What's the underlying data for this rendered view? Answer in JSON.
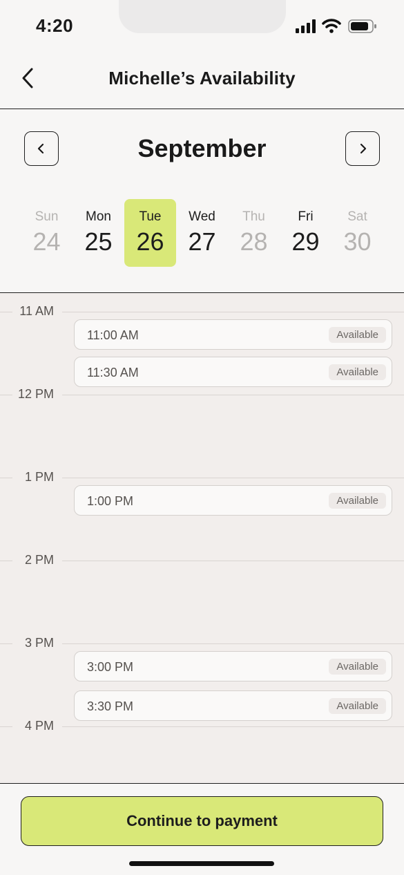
{
  "status_bar": {
    "time": "4:20"
  },
  "header": {
    "title": "Michelle’s Availability"
  },
  "calendar": {
    "month": "September",
    "days": [
      {
        "name": "Sun",
        "number": "24",
        "state": "disabled"
      },
      {
        "name": "Mon",
        "number": "25",
        "state": "enabled"
      },
      {
        "name": "Tue",
        "number": "26",
        "state": "selected"
      },
      {
        "name": "Wed",
        "number": "27",
        "state": "enabled"
      },
      {
        "name": "Thu",
        "number": "28",
        "state": "disabled"
      },
      {
        "name": "Fri",
        "number": "29",
        "state": "enabled"
      },
      {
        "name": "Sat",
        "number": "30",
        "state": "disabled"
      }
    ]
  },
  "schedule": {
    "hours": [
      "11 AM",
      "12 PM",
      "1 PM",
      "2 PM",
      "3 PM",
      "4 PM"
    ],
    "slots": [
      {
        "time": "11:00 AM",
        "status": "Available"
      },
      {
        "time": "11:30 AM",
        "status": "Available"
      },
      {
        "time": "1:00 PM",
        "status": "Available"
      },
      {
        "time": "3:00 PM",
        "status": "Available"
      },
      {
        "time": "3:30 PM",
        "status": "Available"
      }
    ]
  },
  "footer": {
    "cta_label": "Continue to payment"
  },
  "colors": {
    "accent": "#d9e878",
    "background": "#f7f6f5",
    "schedule_background": "#f2eeec",
    "text": "#1a1a1a",
    "muted": "#b5b3b1"
  }
}
